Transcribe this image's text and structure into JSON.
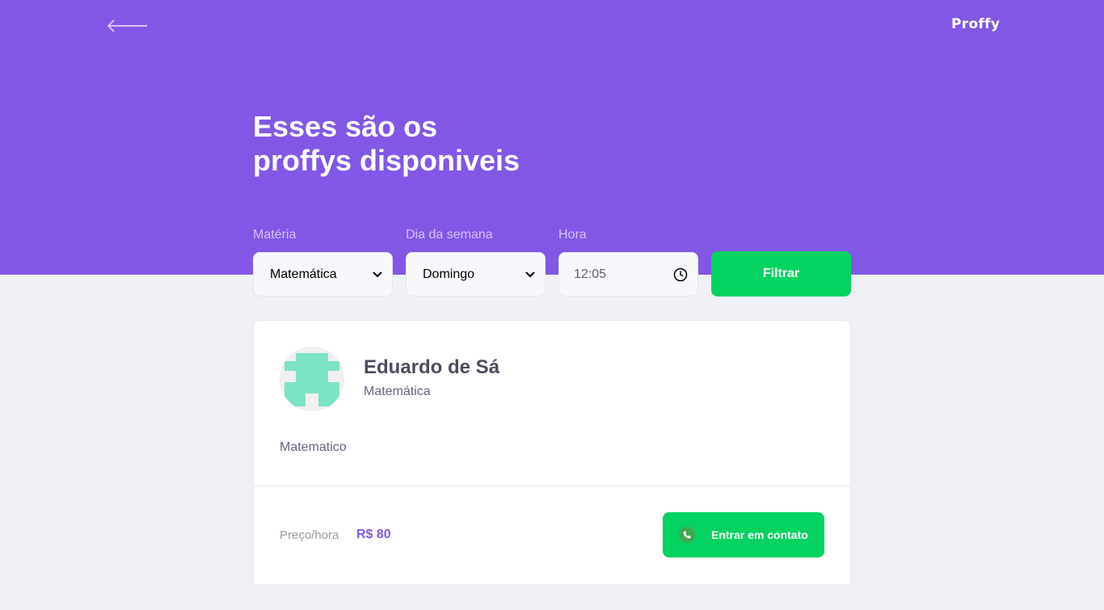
{
  "header": {
    "logo": "Proffy",
    "title_line1": "Esses são os",
    "title_line2": "proffys disponiveis",
    "background_color": "#8257e5"
  },
  "filters": {
    "subject": {
      "label": "Matéria",
      "value": "Matemática"
    },
    "weekday": {
      "label": "Dia da semana",
      "value": "Domingo"
    },
    "time": {
      "label": "Hora",
      "value": "12:05"
    },
    "submit_label": "Filtrar",
    "accent_color": "#04d361"
  },
  "teachers": [
    {
      "name": "Eduardo de Sá",
      "subject": "Matemática",
      "bio": "Matematico",
      "price_label": "Preço/hora",
      "price": "R$ 80",
      "contact_label": "Entrar em contato"
    }
  ]
}
